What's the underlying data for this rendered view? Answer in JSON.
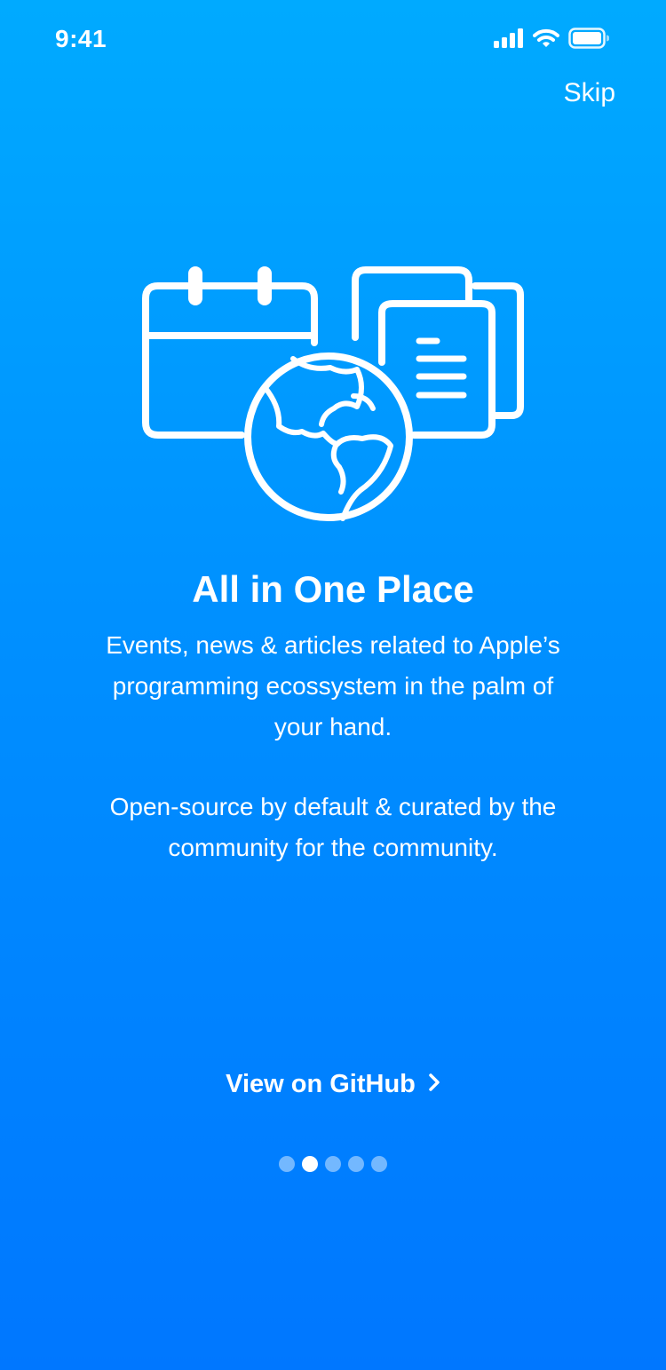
{
  "status_bar": {
    "time": "9:41",
    "icons": [
      "cellular-signal-icon",
      "wifi-icon",
      "battery-icon"
    ]
  },
  "header": {
    "skip_label": "Skip"
  },
  "hero": {
    "icons": [
      "calendar-icon",
      "documents-icon",
      "globe-icon"
    ]
  },
  "onboarding": {
    "title": "All in One Place",
    "description_1": "Events, news & articles related to Apple’s programming ecossystem in the palm of your hand.",
    "description_2": "Open-source by default & curated by the community for the community."
  },
  "actions": {
    "github_label": "View on GitHub",
    "github_icon": "chevron-right-icon"
  },
  "pagination": {
    "total": 5,
    "current": 2
  },
  "colors": {
    "background_top": "#00aaff",
    "background_bottom": "#0077ff",
    "foreground": "#ffffff"
  }
}
